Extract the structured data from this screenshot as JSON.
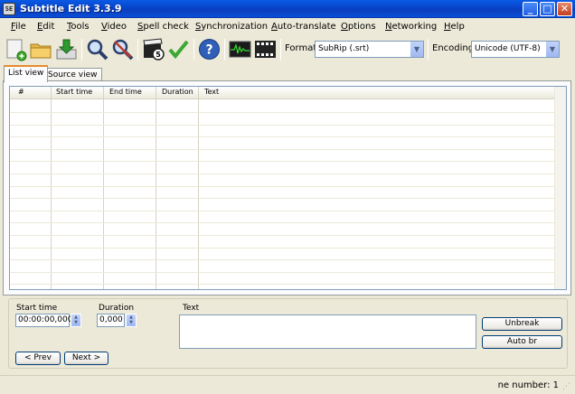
{
  "window": {
    "title": "Subtitle Edit 3.3.9",
    "icon_text": "SE",
    "controls": [
      "_",
      "□",
      "✕"
    ]
  },
  "menu": [
    "File",
    "Edit",
    "Tools",
    "Video",
    "Spell check",
    "Synchronization",
    "Auto-translate",
    "Options",
    "Networking",
    "Help"
  ],
  "toolbar": {
    "icons": [
      "new-file-icon",
      "open-folder-icon",
      "download-save-icon",
      "find-icon",
      "replace-icon",
      "visual-sync-icon",
      "spell-check-icon",
      "help-icon",
      "waveform-icon",
      "video-clapper-icon"
    ],
    "format_label": "Format",
    "format_value": "SubRip (.srt)",
    "encoding_label": "Encoding",
    "encoding_value": "Unicode (UTF-8)"
  },
  "tabs": [
    "List view",
    "Source view"
  ],
  "grid": {
    "columns": [
      "#",
      "Start time",
      "End time",
      "Duration",
      "Text"
    ],
    "rows": []
  },
  "editor": {
    "start_time_label": "Start time",
    "start_time_value": "00:00:00,000",
    "duration_label": "Duration",
    "duration_value": "0,000",
    "text_label": "Text",
    "text_value": "",
    "unbreak_label": "Unbreak",
    "autobr_label": "Auto br",
    "prev_label": "< Prev",
    "next_label": "Next >"
  },
  "status": {
    "text": "ne number: 1"
  }
}
